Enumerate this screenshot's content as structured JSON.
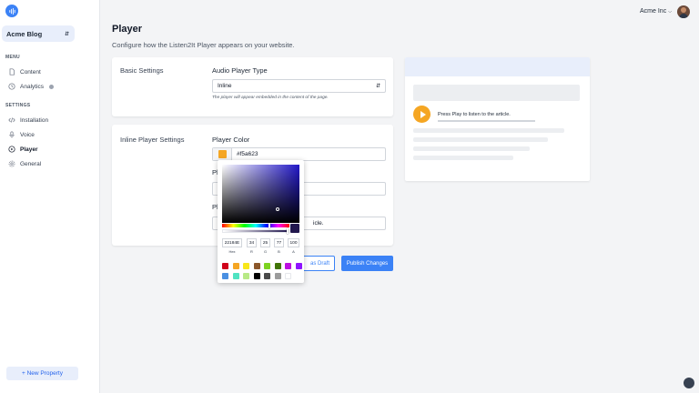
{
  "sidebar": {
    "property": "Acme Blog",
    "menu_label": "MENU",
    "menu": [
      {
        "label": "Content",
        "icon": "document-icon"
      },
      {
        "label": "Analytics",
        "icon": "clock-icon"
      }
    ],
    "settings_label": "SETTINGS",
    "settings": [
      {
        "label": "Installation",
        "icon": "code-icon"
      },
      {
        "label": "Voice",
        "icon": "microphone-icon"
      },
      {
        "label": "Player",
        "icon": "play-circle-icon"
      },
      {
        "label": "General",
        "icon": "gear-icon"
      }
    ],
    "new_property": "+ New Property"
  },
  "topbar": {
    "org": "Acme Inc"
  },
  "page": {
    "title": "Player",
    "subtitle": "Configure how the Listen2It Player appears on your website."
  },
  "basic": {
    "section": "Basic Settings",
    "type_label": "Audio Player Type",
    "type_value": "Inline",
    "type_help": "The player will appear embedded in the content of the page."
  },
  "inline": {
    "section": "Inline Player Settings",
    "color_label": "Player Color",
    "color_value": "#f5a623",
    "field2_label_partial": "Pl",
    "field3_label_partial": "Pl",
    "field3_value_partial": "icle."
  },
  "actions": {
    "draft": "as Draft",
    "publish": "Publish Changes"
  },
  "preview": {
    "play_text": "Press Play to listen to the article."
  },
  "picker": {
    "hex": "22184E",
    "r": "34",
    "g": "25",
    "b": "77",
    "a": "100",
    "labels": {
      "hex": "Hex",
      "r": "R",
      "g": "G",
      "b": "B",
      "a": "A"
    },
    "presets": [
      "#d0021b",
      "#f5a623",
      "#f8e71c",
      "#8b572a",
      "#7ed321",
      "#417505",
      "#bd10e0",
      "#9013fe",
      "#4a90e2",
      "#50e3c2",
      "#b8e986",
      "#000000",
      "#4a4a4a",
      "#9b9b9b",
      "#ffffff"
    ]
  },
  "colors": {
    "accent": "#3b82f6",
    "brand": "#f5a623"
  }
}
